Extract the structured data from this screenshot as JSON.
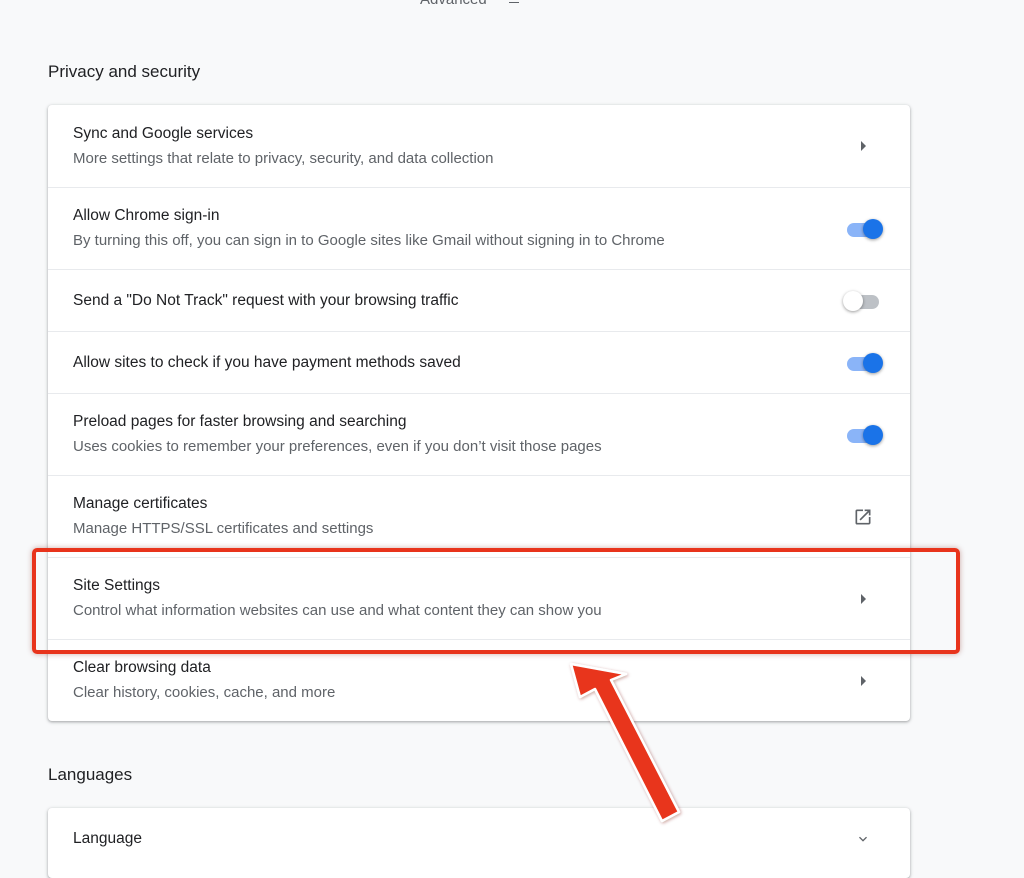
{
  "top": {
    "advanced_label": "Advanced"
  },
  "privacy": {
    "title": "Privacy and security",
    "rows": [
      {
        "title": "Sync and Google services",
        "subtitle": "More settings that relate to privacy, security, and data collection",
        "control": "chevron-right-icon"
      },
      {
        "title": "Allow Chrome sign-in",
        "subtitle": "By turning this off, you can sign in to Google sites like Gmail without signing in to Chrome",
        "control": "toggle",
        "checked": true
      },
      {
        "title": "Send a \"Do Not Track\" request with your browsing traffic",
        "control": "toggle",
        "checked": false
      },
      {
        "title": "Allow sites to check if you have payment methods saved",
        "control": "toggle",
        "checked": true
      },
      {
        "title": "Preload pages for faster browsing and searching",
        "subtitle": "Uses cookies to remember your preferences, even if you don’t visit those pages",
        "control": "toggle",
        "checked": true
      },
      {
        "title": "Manage certificates",
        "subtitle": "Manage HTTPS/SSL certificates and settings",
        "control": "external-link-icon"
      },
      {
        "title": "Site Settings",
        "subtitle": "Control what information websites can use and what content they can show you",
        "control": "chevron-right-icon"
      },
      {
        "title": "Clear browsing data",
        "subtitle": "Clear history, cookies, cache, and more",
        "control": "chevron-right-icon"
      }
    ]
  },
  "languages": {
    "title": "Languages",
    "rows": [
      {
        "title": "Language",
        "control": "chevron-down-icon"
      }
    ]
  },
  "colors": {
    "toggle_on": "#1a73e8",
    "annotation_red": "#e8341c"
  }
}
